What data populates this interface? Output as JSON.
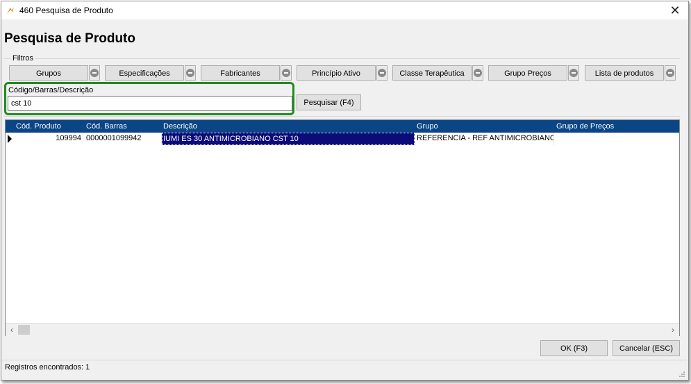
{
  "window": {
    "title": "460 Pesquisa de Produto",
    "close_glyph": "✕"
  },
  "page": {
    "heading": "Pesquisa de Produto"
  },
  "filters": {
    "label": "Filtros",
    "buttons": [
      {
        "label": "Grupos"
      },
      {
        "label": "Especificações"
      },
      {
        "label": "Fabricantes"
      },
      {
        "label": "Princípio Ativo"
      },
      {
        "label": "Classe Terapêutica"
      },
      {
        "label": "Grupo Preços"
      },
      {
        "label": "Lista de produtos"
      }
    ]
  },
  "search": {
    "label": "Código/Barras/Descrição",
    "value": "cst 10",
    "button_label": "Pesquisar (F4)"
  },
  "grid": {
    "columns": [
      "Cód. Produto",
      "Cód. Barras",
      "Descrição",
      "Grupo",
      "Grupo de Preços"
    ],
    "rows": [
      {
        "cod_produto": "109994",
        "cod_barras": "0000001099942",
        "descricao": "IUMI ES 30 ANTIMICROBIANO CST 10",
        "grupo": "REFERENCIA - REF ANTIMICROBIANOS",
        "grupo_precos": ""
      }
    ],
    "scroll_left": "‹",
    "scroll_right": "›"
  },
  "actions": {
    "ok_label": "OK (F3)",
    "cancel_label": "Cancelar (ESC)"
  },
  "status": {
    "text": "Registros encontrados: 1"
  },
  "colors": {
    "header_bg": "#0b4586",
    "selection_bg": "#0b0b7a",
    "highlight_border": "#1e8c1e",
    "accent_icon": "#d08a1a"
  }
}
